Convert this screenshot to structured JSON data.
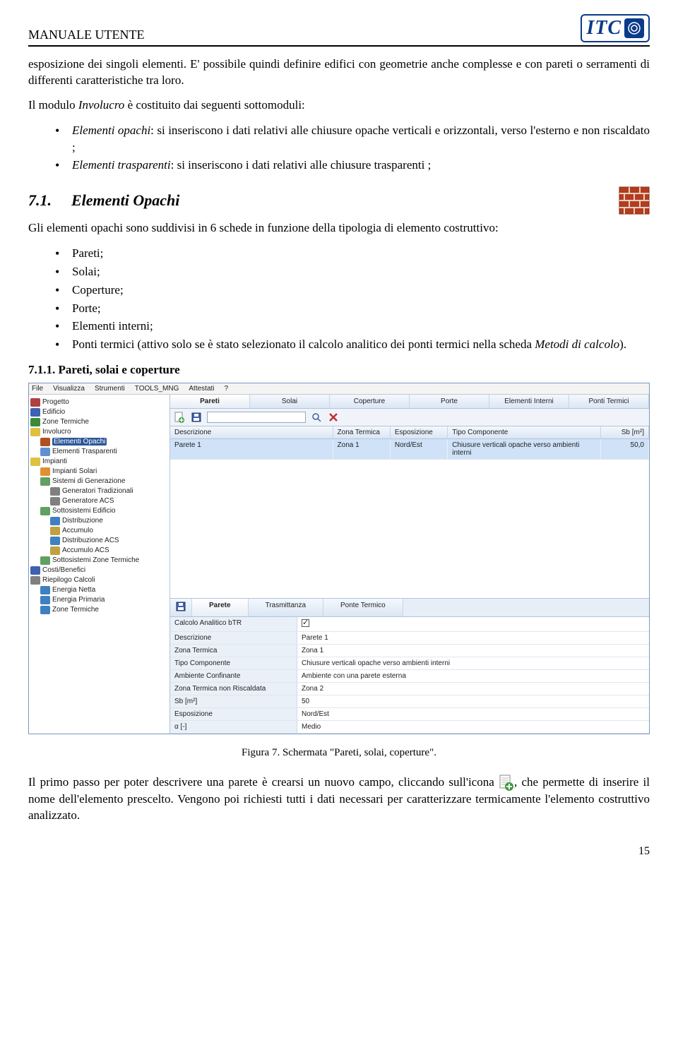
{
  "header": {
    "title": "MANUALE UTENTE",
    "logo_text": "ITC"
  },
  "intro": {
    "p1": "esposizione dei singoli elementi. E' possibile quindi definire edifici con geometrie anche complesse e con pareti o serramenti di differenti caratteristiche tra loro.",
    "p2_a": "Il modulo ",
    "p2_b": "Involucro",
    "p2_c": " è costituito dai seguenti sottomoduli:",
    "li1_a": "Elementi opachi",
    "li1_b": ": si inseriscono i dati relativi alle chiusure opache verticali e orizzontali, verso l'esterno e non riscaldato ;",
    "li2_a": "Elementi trasparenti",
    "li2_b": ": si inseriscono i dati relativi alle chiusure trasparenti ;"
  },
  "section71": {
    "num": "7.1.",
    "title": "Elementi Opachi",
    "intro": "Gli elementi opachi sono suddivisi in 6 schede in funzione della tipologia di elemento costruttivo:",
    "items": [
      "Pareti;",
      "Solai;",
      "Coperture;",
      "Porte;",
      "Elementi interni;"
    ],
    "last_item": "Ponti termici (attivo solo se è stato selezionato il calcolo analitico dei ponti termici nella scheda ",
    "last_item_italic": "Metodi di calcolo",
    "last_item_end": ")."
  },
  "section711": {
    "heading": "7.1.1.  Pareti, solai e coperture"
  },
  "screenshot": {
    "menu": [
      "File",
      "Visualizza",
      "Strumenti",
      "TOOLS_MNG",
      "Attestati",
      "?"
    ],
    "tree": [
      {
        "label": "Progetto",
        "icon": "#b04040",
        "indent": 0
      },
      {
        "label": "Edificio",
        "icon": "#4060b0",
        "indent": 0
      },
      {
        "label": "Zone Termiche",
        "icon": "#3a8a3a",
        "indent": 0
      },
      {
        "label": "Involucro",
        "icon": "#e0c040",
        "indent": 0,
        "exp": true
      },
      {
        "label": "Elementi Opachi",
        "icon": "#b05020",
        "indent": 1,
        "selected": true
      },
      {
        "label": "Elementi Trasparenti",
        "icon": "#6090d0",
        "indent": 1
      },
      {
        "label": "Impianti",
        "icon": "#e0c040",
        "indent": 0,
        "exp": true
      },
      {
        "label": "Impianti Solari",
        "icon": "#e09030",
        "indent": 1
      },
      {
        "label": "Sistemi di Generazione",
        "icon": "#60a060",
        "indent": 1,
        "exp": true
      },
      {
        "label": "Generatori Tradizionali",
        "icon": "#808080",
        "indent": 2
      },
      {
        "label": "Generatore ACS",
        "icon": "#808080",
        "indent": 2
      },
      {
        "label": "Sottosistemi Edificio",
        "icon": "#60a060",
        "indent": 1,
        "exp": true
      },
      {
        "label": "Distribuzione",
        "icon": "#4080c0",
        "indent": 2
      },
      {
        "label": "Accumulo",
        "icon": "#c0a040",
        "indent": 2
      },
      {
        "label": "Distribuzione ACS",
        "icon": "#4080c0",
        "indent": 2
      },
      {
        "label": "Accumulo ACS",
        "icon": "#c0a040",
        "indent": 2
      },
      {
        "label": "Sottosistemi Zone Termiche",
        "icon": "#60a060",
        "indent": 1
      },
      {
        "label": "Costi/Benefici",
        "icon": "#4060b0",
        "indent": 0
      },
      {
        "label": "Riepilogo Calcoli",
        "icon": "#808080",
        "indent": 0,
        "exp": true
      },
      {
        "label": "Energia Netta",
        "icon": "#4080c0",
        "indent": 1
      },
      {
        "label": "Energia Primaria",
        "icon": "#4080c0",
        "indent": 1
      },
      {
        "label": "Zone Termiche",
        "icon": "#4080c0",
        "indent": 1
      }
    ],
    "top_tabs": [
      "Pareti",
      "Solai",
      "Coperture",
      "Porte",
      "Elementi Interni",
      "Ponti Termici"
    ],
    "grid_cols": [
      "Descrizione",
      "Zona Termica",
      "Esposizione",
      "Tipo Componente",
      "Sb [m²]"
    ],
    "grid_row": {
      "desc": "Parete 1",
      "zona": "Zona 1",
      "esp": "Nord/Est",
      "tipo": "Chiusure verticali opache verso ambienti interni",
      "sb": "50,0"
    },
    "bottom_tabs": [
      "Parete",
      "Trasmittanza",
      "Ponte Termico"
    ],
    "props": [
      {
        "label": "Calcolo Analitico bTR",
        "val": "",
        "check": true
      },
      {
        "label": "Descrizione",
        "val": "Parete 1"
      },
      {
        "label": "Zona Termica",
        "val": "Zona 1"
      },
      {
        "label": "Tipo Componente",
        "val": "Chiusure verticali opache verso ambienti interni"
      },
      {
        "label": "Ambiente Confinante",
        "val": "Ambiente con una parete esterna"
      },
      {
        "label": "Zona Termica non Riscaldata",
        "val": "Zona 2"
      },
      {
        "label": "Sb [m²]",
        "val": "50"
      },
      {
        "label": "Esposizione",
        "val": "Nord/Est"
      },
      {
        "label": "α [-]",
        "val": "Medio"
      }
    ]
  },
  "caption": "Figura 7. Schermata \"Pareti, solai, coperture\".",
  "closing": {
    "a": "Il primo passo per poter descrivere una parete è crearsi un nuovo campo, cliccando sull'icona ",
    "b": ", che permette di inserire il nome dell'elemento prescelto. Vengono poi richiesti tutti i dati necessari per caratterizzare termicamente l'elemento costruttivo analizzato."
  },
  "page_number": "15"
}
